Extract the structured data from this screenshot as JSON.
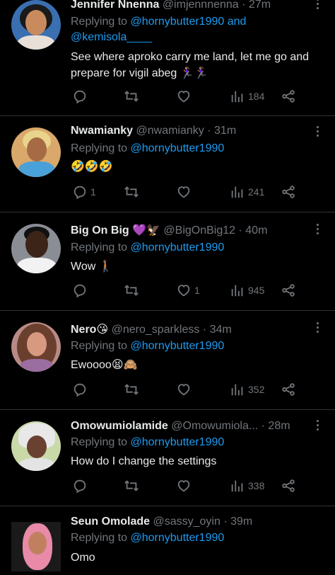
{
  "tweets": [
    {
      "name": "Jennifer Nnenna",
      "handle": "@imjennnenna",
      "dot": "·",
      "time": "27m",
      "replying_prefix": "Replying to ",
      "replying_to": "@hornybutter1990 and\n@kemisola____",
      "text": "See where aproko carry me land, let me go and prepare for vigil abeg 🏃🏽‍♀️🏃🏽‍♀️",
      "replies": "",
      "retweets": "",
      "likes": "",
      "views": "184"
    },
    {
      "name": "Nwamianky",
      "handle": "@nwamianky",
      "dot": "·",
      "time": "31m",
      "replying_prefix": "Replying to ",
      "replying_to": "@hornybutter1990",
      "text": "🤣🤣🤣",
      "replies": "1",
      "retweets": "",
      "likes": "",
      "views": "241"
    },
    {
      "name": "Big On Big 💜🦅",
      "handle": "@BigOnBig12",
      "dot": "·",
      "time": "40m",
      "replying_prefix": "Replying to ",
      "replying_to": "@hornybutter1990",
      "text": "Wow 🚶🏽",
      "replies": "",
      "retweets": "",
      "likes": "1",
      "views": "945"
    },
    {
      "name": "Nero😘",
      "handle": "@nero_sparkless",
      "dot": "·",
      "time": "34m",
      "replying_prefix": "Replying to ",
      "replying_to": "@hornybutter1990",
      "text": "Ewoooo😫🙈",
      "replies": "",
      "retweets": "",
      "likes": "",
      "views": "352"
    },
    {
      "name": "Omowumiolamide",
      "handle": "@Omowumiola...",
      "dot": "·",
      "time": "28m",
      "replying_prefix": "Replying to ",
      "replying_to": "@hornybutter1990",
      "text": "How do I change the settings",
      "replies": "",
      "retweets": "",
      "likes": "",
      "views": "338"
    },
    {
      "name": "Seun Omolade",
      "handle": "@sassy_oyin",
      "dot": "·",
      "time": "39m",
      "replying_prefix": "Replying to ",
      "replying_to": "@hornybutter1990",
      "text": "Omo"
    }
  ],
  "icons": {
    "reply": "reply-icon",
    "retweet": "retweet-icon",
    "like": "heart-icon",
    "views": "views-icon",
    "share": "share-icon",
    "more": "more-icon"
  },
  "colors": {
    "background": "#000000",
    "text": "#e7e9ea",
    "secondary": "#71767b",
    "link": "#1d9bf0",
    "divider": "#2f3336"
  }
}
